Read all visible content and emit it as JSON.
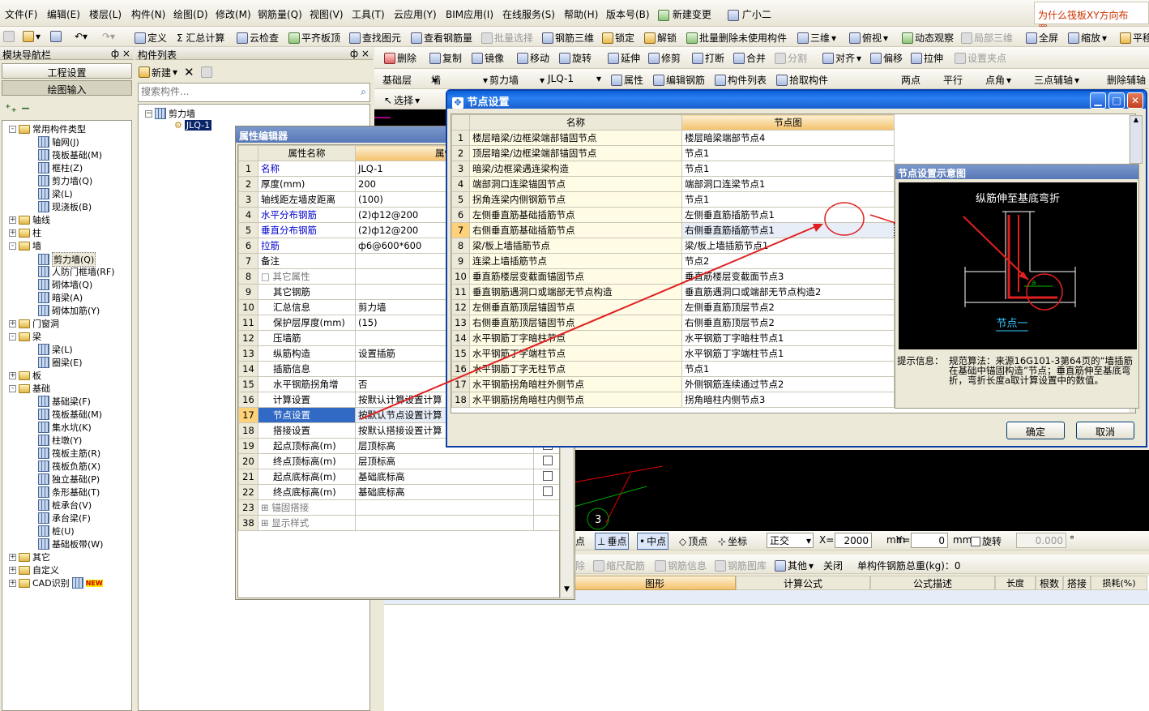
{
  "menu": {
    "items": [
      "文件(F)",
      "编辑(E)",
      "楼层(L)",
      "构件(N)",
      "绘图(D)",
      "修改(M)",
      "钢筋量(Q)",
      "视图(V)",
      "工具(T)",
      "云应用(Y)",
      "BIM应用(I)",
      "在线服务(S)",
      "帮助(H)",
      "版本号(B)",
      "新建变更",
      "广小二"
    ],
    "right_tip": "为什么筏板XY方向布置…"
  },
  "toolbar1": [
    "定义",
    "Σ 汇总计算",
    "云检查",
    "平齐板顶",
    "查找图元",
    "查看钢筋量",
    "批量选择",
    "钢筋三维",
    "锁定",
    "解锁",
    "批量删除未使用构件",
    "三维",
    "俯视",
    "动态观察",
    "局部三维",
    "全屏",
    "缩放",
    "平移"
  ],
  "toolbar2": [
    "删除",
    "复制",
    "镜像",
    "移动",
    "旋转",
    "延伸",
    "修剪",
    "打断",
    "合并",
    "分割",
    "对齐",
    "偏移",
    "拉伸",
    "设置夹点"
  ],
  "toolbar3": {
    "layer": "基础层",
    "type": "墙",
    "sub": "剪力墙",
    "item": "JLQ-1",
    "buttons": [
      "属性",
      "编辑钢筋",
      "构件列表",
      "拾取构件"
    ],
    "right": [
      "两点",
      "平行",
      "点角",
      "三点辅轴",
      "删除辅轴"
    ]
  },
  "toolbar4": {
    "select": "选择"
  },
  "nav": {
    "title": "模块导航栏",
    "pin": "ф ×",
    "btn1": "工程设置",
    "btn2": "绘图输入",
    "tree": [
      {
        "t": "常用构件类型",
        "lvl": 0,
        "exp": "-"
      },
      {
        "t": "轴网(J)",
        "lvl": 1
      },
      {
        "t": "筏板基础(M)",
        "lvl": 1
      },
      {
        "t": "框柱(Z)",
        "lvl": 1
      },
      {
        "t": "剪力墙(Q)",
        "lvl": 1
      },
      {
        "t": "梁(L)",
        "lvl": 1
      },
      {
        "t": "现浇板(B)",
        "lvl": 1
      },
      {
        "t": "轴线",
        "lvl": 0,
        "exp": "+"
      },
      {
        "t": "柱",
        "lvl": 0,
        "exp": "+"
      },
      {
        "t": "墙",
        "lvl": 0,
        "exp": "-"
      },
      {
        "t": "剪力墙(Q)",
        "lvl": 1,
        "sel": true
      },
      {
        "t": "人防门框墙(RF)",
        "lvl": 1
      },
      {
        "t": "砌体墙(Q)",
        "lvl": 1
      },
      {
        "t": "暗梁(A)",
        "lvl": 1
      },
      {
        "t": "砌体加筋(Y)",
        "lvl": 1
      },
      {
        "t": "门窗洞",
        "lvl": 0,
        "exp": "+"
      },
      {
        "t": "梁",
        "lvl": 0,
        "exp": "-"
      },
      {
        "t": "梁(L)",
        "lvl": 1
      },
      {
        "t": "圈梁(E)",
        "lvl": 1
      },
      {
        "t": "板",
        "lvl": 0,
        "exp": "+"
      },
      {
        "t": "基础",
        "lvl": 0,
        "exp": "-"
      },
      {
        "t": "基础梁(F)",
        "lvl": 1
      },
      {
        "t": "筏板基础(M)",
        "lvl": 1
      },
      {
        "t": "集水坑(K)",
        "lvl": 1
      },
      {
        "t": "柱墩(Y)",
        "lvl": 1
      },
      {
        "t": "筏板主筋(R)",
        "lvl": 1
      },
      {
        "t": "筏板负筋(X)",
        "lvl": 1
      },
      {
        "t": "独立基础(P)",
        "lvl": 1
      },
      {
        "t": "条形基础(T)",
        "lvl": 1
      },
      {
        "t": "桩承台(V)",
        "lvl": 1
      },
      {
        "t": "承台梁(F)",
        "lvl": 1
      },
      {
        "t": "桩(U)",
        "lvl": 1
      },
      {
        "t": "基础板带(W)",
        "lvl": 1
      },
      {
        "t": "其它",
        "lvl": 0,
        "exp": "+"
      },
      {
        "t": "自定义",
        "lvl": 0,
        "exp": "+"
      },
      {
        "t": "CAD识别",
        "lvl": 0,
        "exp": "+",
        "badge": "NEW"
      }
    ]
  },
  "comp": {
    "title": "构件列表",
    "new": "新建",
    "search_ph": "搜索构件...",
    "tree_root": "剪力墙",
    "tree_item": "JLQ-1"
  },
  "props": {
    "title": "属性编辑器",
    "h1": "属性名称",
    "h2": "属性",
    "rows": [
      [
        "1",
        "名称",
        "JLQ-1",
        1
      ],
      [
        "2",
        "厚度(mm)",
        "200",
        0
      ],
      [
        "3",
        "轴线距左墙皮距离",
        "(100)",
        0
      ],
      [
        "4",
        "水平分布钢筋",
        "(2)ф12@200",
        1
      ],
      [
        "5",
        "垂直分布钢筋",
        "(2)ф12@200",
        1
      ],
      [
        "6",
        "拉筋",
        "ф6@600*600",
        1
      ],
      [
        "7",
        "备注",
        "",
        0
      ],
      [
        "8",
        "□ 其它属性",
        "",
        2
      ],
      [
        "9",
        "其它钢筋",
        "",
        3
      ],
      [
        "10",
        "汇总信息",
        "剪力墙",
        3
      ],
      [
        "11",
        "保护层厚度(mm)",
        "(15)",
        3
      ],
      [
        "12",
        "压墙筋",
        "",
        3
      ],
      [
        "13",
        "纵筋构造",
        "设置插筋",
        3
      ],
      [
        "14",
        "插筋信息",
        "",
        3
      ],
      [
        "15",
        "水平钢筋拐角增",
        "否",
        3
      ],
      [
        "16",
        "计算设置",
        "按默认计算设置计算",
        3
      ],
      [
        "17",
        "节点设置",
        "按默认节点设置计算",
        4
      ],
      [
        "18",
        "搭接设置",
        "按默认搭接设置计算",
        3
      ],
      [
        "19",
        "起点顶标高(m)",
        "层顶标高",
        3
      ],
      [
        "20",
        "终点顶标高(m)",
        "层顶标高",
        3
      ],
      [
        "21",
        "起点底标高(m)",
        "基础底标高",
        3
      ],
      [
        "22",
        "终点底标高(m)",
        "基础底标高",
        3
      ],
      [
        "23",
        "⊞ 锚固搭接",
        "",
        2
      ],
      [
        "38",
        "⊞ 显示样式",
        "",
        2
      ]
    ]
  },
  "dialog": {
    "title": "节点设置",
    "col_name": "名称",
    "col_node": "节点图",
    "rows": [
      [
        "1",
        "楼层暗梁/边框梁端部锚固节点",
        "楼层暗梁端部节点4"
      ],
      [
        "2",
        "顶层暗梁/边框梁端部锚固节点",
        "节点1"
      ],
      [
        "3",
        "暗梁/边框梁遇连梁构造",
        "节点1"
      ],
      [
        "4",
        "端部洞口连梁锚固节点",
        "端部洞口连梁节点1"
      ],
      [
        "5",
        "拐角连梁内侧钢筋节点",
        "节点1"
      ],
      [
        "6",
        "左侧垂直筋基础插筋节点",
        "左侧垂直筋插筋节点1"
      ],
      [
        "7",
        "右侧垂直筋基础插筋节点",
        "右侧垂直筋插筋节点1"
      ],
      [
        "8",
        "梁/板上墙插筋节点",
        "梁/板上墙插筋节点1"
      ],
      [
        "9",
        "连梁上墙插筋节点",
        "节点2"
      ],
      [
        "10",
        "垂直筋楼层变截面锚固节点",
        "垂直筋楼层变截面节点3"
      ],
      [
        "11",
        "垂直钢筋遇洞口或端部无节点构造",
        "垂直筋遇洞口或端部无节点构造2"
      ],
      [
        "12",
        "左侧垂直筋顶层锚固节点",
        "左侧垂直筋顶层节点2"
      ],
      [
        "13",
        "右侧垂直筋顶层锚固节点",
        "右侧垂直筋顶层节点2"
      ],
      [
        "14",
        "水平钢筋丁字暗柱节点",
        "水平钢筋丁字暗柱节点1"
      ],
      [
        "15",
        "水平钢筋丁字端柱节点",
        "水平钢筋丁字端柱节点1"
      ],
      [
        "16",
        "水平钢筋丁字无柱节点",
        "节点1"
      ],
      [
        "17",
        "水平钢筋拐角暗柱外侧节点",
        "外侧钢筋连续通过节点2"
      ],
      [
        "18",
        "水平钢筋拐角暗柱内侧节点",
        "拐角暗柱内侧节点3"
      ]
    ],
    "diagram_title": "节点设置示意图",
    "diagram_caption": "纵筋伸至基底弯折",
    "diagram_node": "节点一",
    "diagram_a": "a",
    "hint_label": "提示信息：",
    "hint_text": "规范算法：来源16G101-3第64页的“墙插筋在基础中锚固构造”节点；垂直筋伸至基底弯折，弯折长度a取计算设置中的数值。",
    "ok": "确定",
    "cancel": "取消"
  },
  "snapbar": {
    "items": [
      "点",
      "垂点",
      "中点",
      "顶点",
      "坐标"
    ],
    "mode": "正交",
    "x_label": "X=",
    "x": "2000",
    "y_label": "Y=",
    "y": "0",
    "unit": "mm",
    "rotate": "旋转",
    "rotate_val": "0.000",
    "deg": "°"
  },
  "rebarbar": {
    "items": [
      "除",
      "缩尺配筋",
      "钢筋信息",
      "钢筋图库",
      "其他",
      "关闭"
    ],
    "total": "单构件钢筋总重(kg)：0"
  },
  "rebartable": {
    "headers": [
      "图形",
      "计算公式",
      "公式描述",
      "长度(mm)",
      "根数",
      "搭接",
      "损耗(%)"
    ]
  },
  "cad_marker": "3"
}
